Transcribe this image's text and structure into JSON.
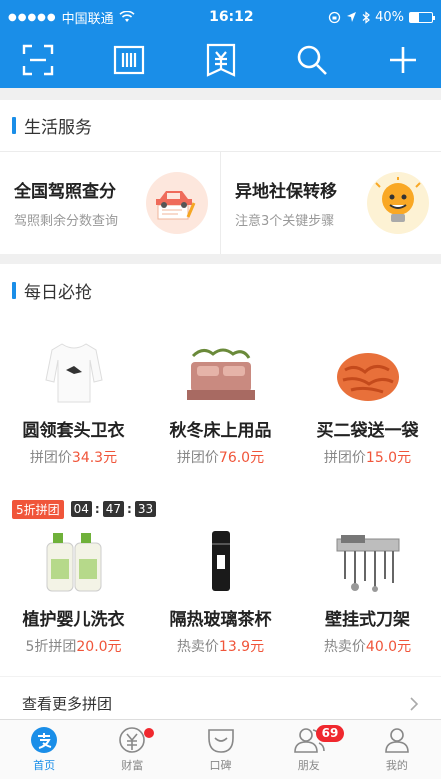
{
  "status_bar": {
    "carrier": "中国联通",
    "signal_dots": "●●●●●",
    "time": "16:12",
    "battery": "40%"
  },
  "toolbar": {
    "icons": [
      "scan-icon",
      "barcode-icon",
      "payment-code-icon",
      "search-icon",
      "add-icon"
    ]
  },
  "life_services": {
    "title": "生活服务",
    "cards": [
      {
        "title": "全国驾照查分",
        "subtitle": "驾照剩余分数查询",
        "icon": "car-illustration-icon"
      },
      {
        "title": "异地社保转移",
        "subtitle": "注意3个关键步骤",
        "icon": "lightbulb-illustration-icon"
      }
    ]
  },
  "daily_deals": {
    "title": "每日必抢",
    "row1": [
      {
        "name": "圆领套头卫衣",
        "price_label": "拼团价",
        "price": "34.3元",
        "icon": "sweatshirt-image"
      },
      {
        "name": "秋冬床上用品",
        "price_label": "拼团价",
        "price": "76.0元",
        "icon": "bedding-image"
      },
      {
        "name": "买二袋送一袋",
        "price_label": "拼团价",
        "price": "15.0元",
        "icon": "snack-image"
      }
    ],
    "flash": {
      "tag": "5折拼团",
      "hh": "04",
      "mm": "47",
      "ss": "33"
    },
    "row2": [
      {
        "name": "植护婴儿洗衣",
        "price_label": "5折拼团",
        "price": "20.0元",
        "icon": "detergent-image"
      },
      {
        "name": "隔热玻璃茶杯",
        "price_label": "热卖价",
        "price": "13.9元",
        "icon": "tea-cup-image"
      },
      {
        "name": "壁挂式刀架",
        "price_label": "热卖价",
        "price": "40.0元",
        "icon": "knife-rack-image"
      }
    ],
    "more_label": "查看更多拼团"
  },
  "tabbar": {
    "tabs": [
      {
        "label": "首页",
        "icon": "alipay-home-icon",
        "active": true
      },
      {
        "label": "财富",
        "icon": "wealth-icon",
        "active": false
      },
      {
        "label": "口碑",
        "icon": "koubei-icon",
        "active": false
      },
      {
        "label": "朋友",
        "icon": "friends-icon",
        "active": false,
        "badge": "69"
      },
      {
        "label": "我的",
        "icon": "profile-icon",
        "active": false
      }
    ]
  },
  "colors": {
    "brand": "#1a8ee8",
    "price": "#f0553a",
    "badge": "#f0282e"
  }
}
